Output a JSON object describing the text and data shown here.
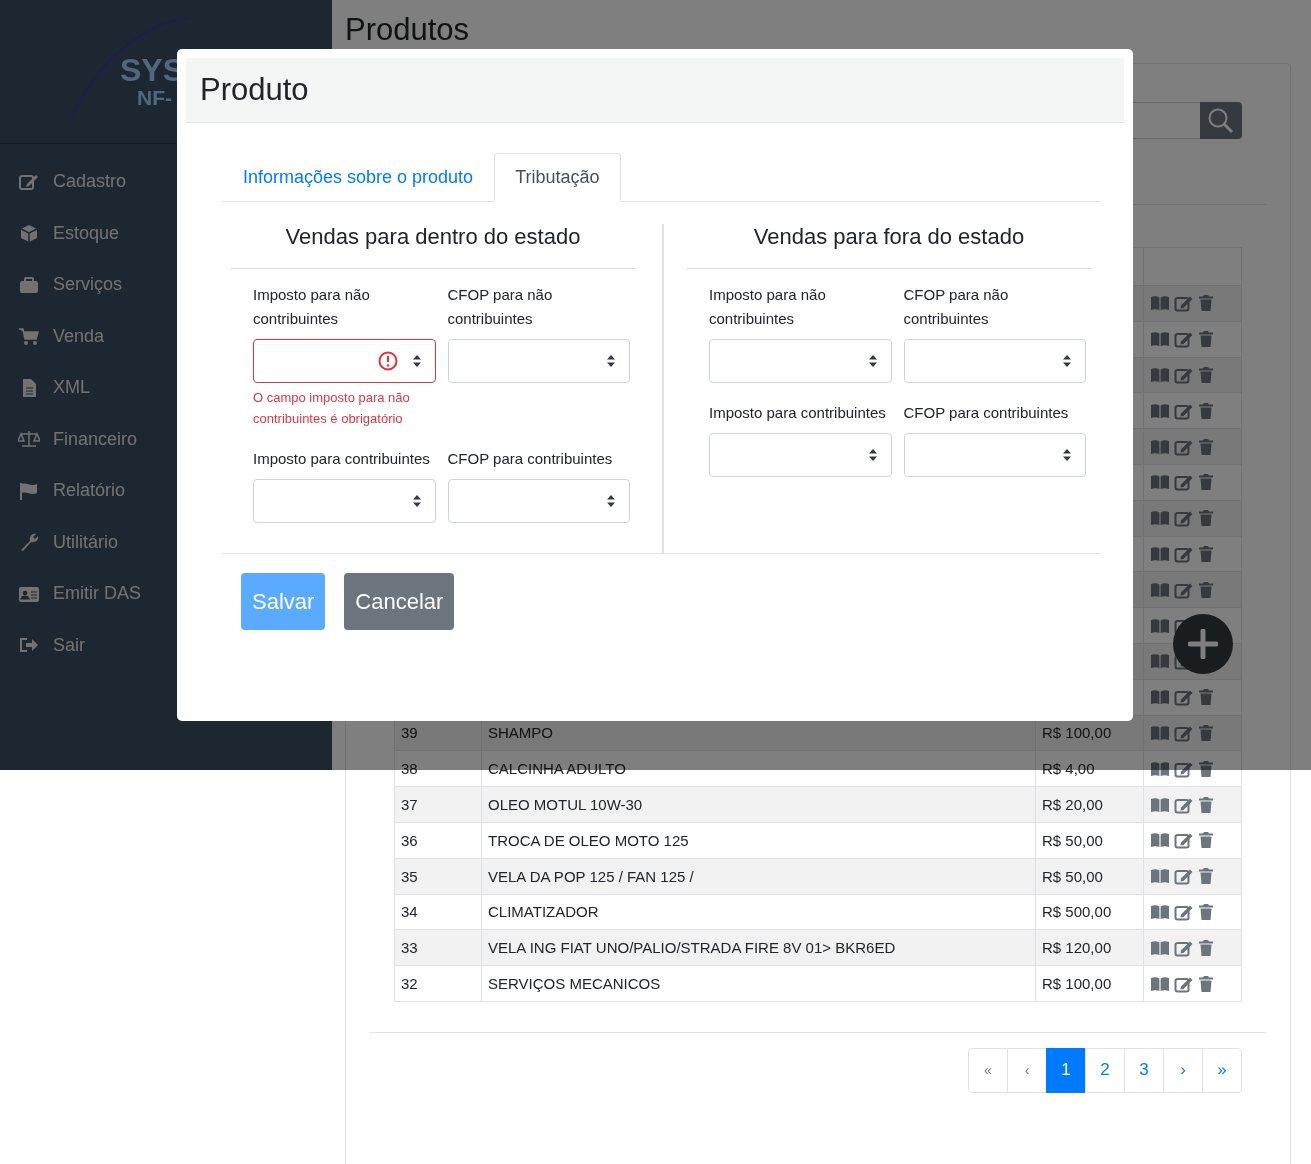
{
  "sidebar": {
    "logo": {
      "line1": "SYS",
      "line2": "NF-"
    },
    "items": [
      {
        "label": "Cadastro",
        "kind": "edit"
      },
      {
        "label": "Estoque",
        "kind": "box"
      },
      {
        "label": "Serviços",
        "kind": "briefcase"
      },
      {
        "label": "Venda",
        "kind": "cart"
      },
      {
        "label": "XML",
        "kind": "file"
      },
      {
        "label": "Financeiro",
        "kind": "scale"
      },
      {
        "label": "Relatório",
        "kind": "flag"
      },
      {
        "label": "Utilitário",
        "kind": "wrench"
      },
      {
        "label": "Emitir DAS",
        "kind": "idcard"
      },
      {
        "label": "Sair",
        "kind": "signout"
      }
    ]
  },
  "page": {
    "title": "Produtos"
  },
  "table": {
    "rows": [
      {
        "kind": "covered"
      },
      {
        "kind": "covered"
      },
      {
        "kind": "covered"
      },
      {
        "kind": "covered"
      },
      {
        "kind": "covered"
      },
      {
        "kind": "covered"
      },
      {
        "kind": "covered"
      },
      {
        "kind": "covered"
      },
      {
        "kind": "covered"
      },
      {
        "kind": "covered_partial"
      },
      {
        "kind": "covered_partial"
      },
      {
        "kind": "covered"
      },
      {
        "kind": "full",
        "id": "39",
        "product": "SHAMPO",
        "price": "R$ 100,00"
      },
      {
        "kind": "full",
        "id": "38",
        "product": "CALCINHA ADULTO",
        "price": "R$ 4,00"
      },
      {
        "kind": "full",
        "id": "37",
        "product": "OLEO MOTUL 10W-30",
        "price": "R$ 20,00"
      },
      {
        "kind": "full",
        "id": "36",
        "product": "TROCA DE OLEO MOTO 125",
        "price": "R$ 50,00"
      },
      {
        "kind": "full",
        "id": "35",
        "product": "VELA DA POP 125 / FAN 125 /",
        "price": "R$ 50,00"
      },
      {
        "kind": "full",
        "id": "34",
        "product": "CLIMATIZADOR",
        "price": "R$ 500,00"
      },
      {
        "kind": "full",
        "id": "33",
        "product": "VELA ING FIAT UNO/PALIO/STRADA FIRE 8V 01> BKR6ED",
        "price": "R$ 120,00"
      },
      {
        "kind": "full",
        "id": "32",
        "product": "SERVIÇOS MECANICOS",
        "price": "R$ 100,00"
      }
    ]
  },
  "pagination": [
    {
      "label": "«",
      "selected": false,
      "disabled": true
    },
    {
      "label": "‹",
      "selected": false,
      "disabled": true
    },
    {
      "label": "1",
      "selected": true,
      "disabled": false
    },
    {
      "label": "2",
      "selected": false,
      "disabled": false
    },
    {
      "label": "3",
      "selected": false,
      "disabled": false
    },
    {
      "label": "›",
      "selected": false,
      "disabled": false
    },
    {
      "label": "»",
      "selected": false,
      "disabled": false
    }
  ],
  "dialog": {
    "title": "Produto",
    "tabs": [
      {
        "label": "Informações sobre o produto",
        "selected": false
      },
      {
        "label": "Tributação",
        "selected": true
      }
    ],
    "sections": [
      {
        "title": "Vendas para dentro do estado",
        "fields": [
          {
            "label": "Imposto para não contribuintes",
            "invalid": true,
            "error": "O campo imposto para não contribuintes é obrigatório"
          },
          {
            "label": "CFOP para não contribuintes",
            "invalid": false
          },
          {
            "label": "Imposto para contribuintes",
            "invalid": false
          },
          {
            "label": "CFOP para contribuintes",
            "invalid": false
          }
        ]
      },
      {
        "title": "Vendas para fora do estado",
        "fields": [
          {
            "label": "Imposto para não contribuintes",
            "invalid": false
          },
          {
            "label": "CFOP para não contribuintes",
            "invalid": false
          },
          {
            "label": "Imposto para contribuintes",
            "invalid": false
          },
          {
            "label": "CFOP para contribuintes",
            "invalid": false
          }
        ]
      }
    ],
    "buttons": [
      {
        "label": "Salvar",
        "kind": "primary",
        "disabled": true
      },
      {
        "label": "Cancelar",
        "kind": "secondary",
        "disabled": false
      }
    ]
  }
}
